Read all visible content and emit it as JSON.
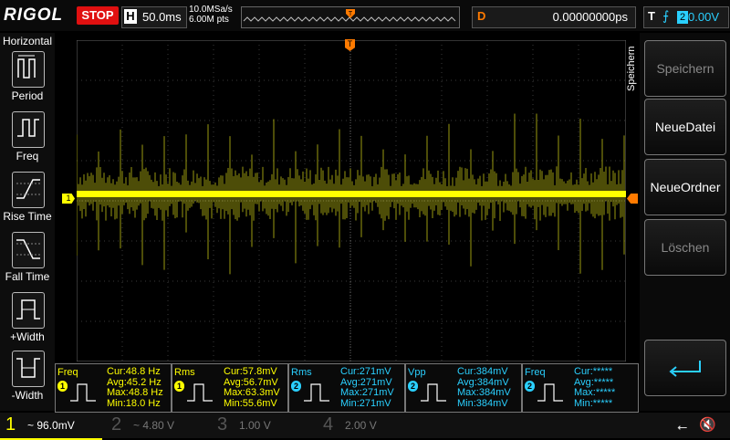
{
  "brand": "RIGOL",
  "run_state": "STOP",
  "horizontal": {
    "key": "H",
    "timebase": "50.0ms"
  },
  "sampling": {
    "rate": "10.0MSa/s",
    "points": "6.00M pts"
  },
  "delay": {
    "key": "D",
    "value": "0.00000000ps"
  },
  "trigger": {
    "key": "T",
    "edge": "rising-edge-icon",
    "source": "2",
    "level": "0.00V"
  },
  "left_panel": {
    "title": "Horizontal",
    "buttons": [
      {
        "label": "Period",
        "icon": "period-icon"
      },
      {
        "label": "Freq",
        "icon": "freq-icon"
      },
      {
        "label": "Rise Time",
        "icon": "rise-time-icon"
      },
      {
        "label": "Fall Time",
        "icon": "fall-time-icon"
      },
      {
        "label": "+Width",
        "icon": "pos-width-icon"
      },
      {
        "label": "-Width",
        "icon": "neg-width-icon"
      }
    ]
  },
  "right_panel": {
    "title": "Speichern",
    "buttons": [
      {
        "label": "Speichern",
        "enabled": false
      },
      {
        "label": "NeueDatei",
        "enabled": true
      },
      {
        "label": "NeueOrdner",
        "enabled": true
      },
      {
        "label": "Löschen",
        "enabled": false
      },
      {
        "label": "",
        "icon": "return-arrow-icon",
        "enabled": true
      }
    ]
  },
  "ch1_marker": "1",
  "measurements": [
    {
      "name": "Freq",
      "channel": "1",
      "cur": "Cur:48.8 Hz",
      "avg": "Avg:45.2 Hz",
      "max": "Max:48.8 Hz",
      "min": "Min:18.0 Hz"
    },
    {
      "name": "Rms",
      "channel": "1",
      "cur": "Cur:57.8mV",
      "avg": "Avg:56.7mV",
      "max": "Max:63.3mV",
      "min": "Min:55.6mV"
    },
    {
      "name": "Rms",
      "channel": "2",
      "cur": "Cur:271mV",
      "avg": "Avg:271mV",
      "max": "Max:271mV",
      "min": "Min:271mV"
    },
    {
      "name": "Vpp",
      "channel": "2",
      "cur": "Cur:384mV",
      "avg": "Avg:384mV",
      "max": "Max:384mV",
      "min": "Min:384mV"
    },
    {
      "name": "Freq",
      "channel": "2",
      "cur": "Cur:*****",
      "avg": "Avg:*****",
      "max": "Max:*****",
      "min": "Min:*****"
    }
  ],
  "channels": [
    {
      "num": "1",
      "value": "~ 96.0mV",
      "color": "#ffff00",
      "active": true
    },
    {
      "num": "2",
      "value": "~ 4.80 V",
      "color": "#2ad0ff",
      "active": false
    },
    {
      "num": "3",
      "value": "1.00 V",
      "color": "#ff33ff",
      "active": false
    },
    {
      "num": "4",
      "value": "2.00 V",
      "color": "#3399ff",
      "active": false
    }
  ],
  "colors": {
    "ch1": "#ffff00",
    "ch2": "#2ad0ff",
    "trigger": "#ff7a00",
    "stop": "#e01010"
  }
}
